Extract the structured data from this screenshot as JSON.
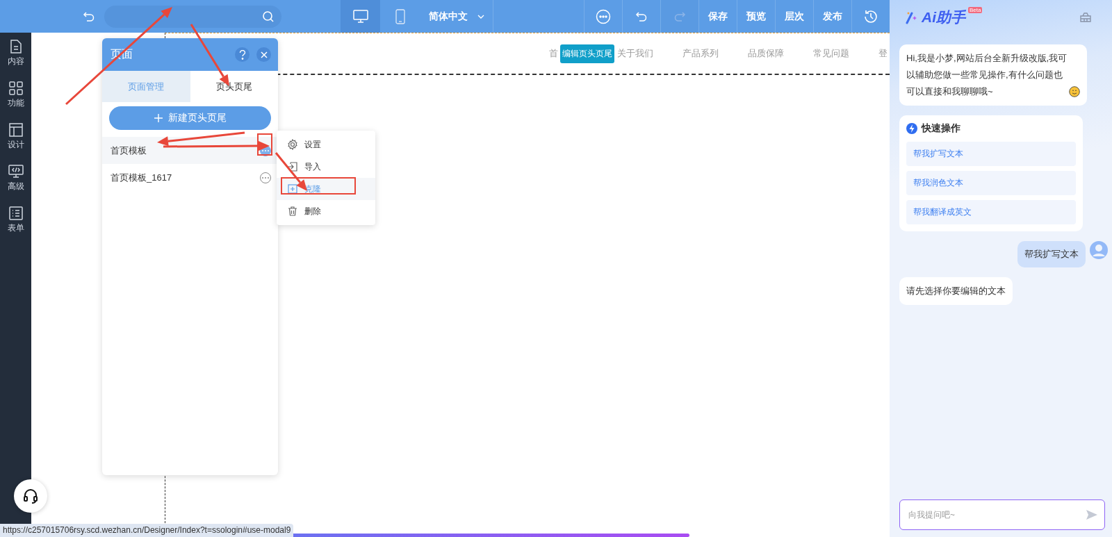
{
  "toolbar": {
    "devices": [
      {
        "kind": "desktop",
        "selected": true
      },
      {
        "kind": "mobile",
        "selected": false
      }
    ],
    "language": "简体中文",
    "actions": [
      {
        "kind": "more",
        "disabled": false
      },
      {
        "kind": "undo",
        "disabled": false
      },
      {
        "kind": "redo",
        "disabled": true
      },
      {
        "kind": "text",
        "label": "保存",
        "disabled": false
      },
      {
        "kind": "text",
        "label": "预览",
        "disabled": false
      },
      {
        "kind": "text",
        "label": "层次",
        "disabled": false
      },
      {
        "kind": "text",
        "label": "发布",
        "disabled": false
      },
      {
        "kind": "history",
        "disabled": false
      }
    ]
  },
  "sidebar": {
    "items": [
      {
        "kind": "content",
        "label": "内容"
      },
      {
        "kind": "features",
        "label": "功能"
      },
      {
        "kind": "design",
        "label": "设计"
      },
      {
        "kind": "advanced",
        "label": "高级"
      },
      {
        "kind": "form",
        "label": "表单"
      }
    ]
  },
  "page_panel": {
    "title": "页面",
    "tabs": [
      {
        "label": "页面管理",
        "selected": false
      },
      {
        "label": "页头页尾",
        "selected": true
      }
    ],
    "new_button": "新建页头页尾",
    "items": [
      {
        "label": "首页模板",
        "selected": true
      },
      {
        "label": "首页模板_1617",
        "selected": false
      }
    ],
    "menu": [
      {
        "kind": "settings",
        "label": "设置",
        "selected": false
      },
      {
        "kind": "import",
        "label": "导入",
        "selected": false
      },
      {
        "kind": "clone",
        "label": "克隆",
        "selected": true
      },
      {
        "kind": "delete",
        "label": "删除",
        "selected": false
      }
    ]
  },
  "canvas": {
    "nav": [
      "首",
      "关于我们",
      "产品系列",
      "品质保障",
      "常见问题",
      "登"
    ],
    "tooltip": "编辑页头页尾"
  },
  "assistant": {
    "title": "Ai助手",
    "badge": "Beta",
    "messages": [
      {
        "kind": "bot",
        "text": "Hi,我是小梦,网站后台全新升级改版,我可以辅助您做一些常见操作,有什么问题也可以直接和我聊聊哦~"
      },
      {
        "kind": "quick",
        "title": "快速操作",
        "options": [
          "帮我扩写文本",
          "帮我润色文本",
          "帮我翻译成英文"
        ]
      },
      {
        "kind": "user",
        "text": "帮我扩写文本"
      },
      {
        "kind": "bot",
        "text": "请先选择你要编辑的文本"
      }
    ],
    "input": {
      "placeholder": "向我提问吧~"
    }
  },
  "status_bar": {
    "url": "https://c257015706rsy.scd.wezhan.cn/Designer/Index?t=ssologin#use-modal9"
  },
  "loading": {
    "level": 0.62
  }
}
